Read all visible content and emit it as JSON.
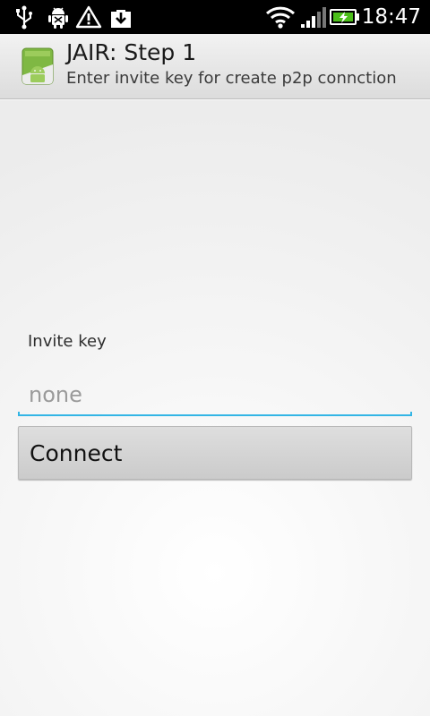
{
  "status_bar": {
    "time": "18:47",
    "icons": [
      "usb-icon",
      "android-debug-icon",
      "warning-icon",
      "download-icon",
      "wifi-icon",
      "signal-icon",
      "battery-charging-icon"
    ]
  },
  "title_bar": {
    "title": "JAIR: Step 1",
    "subtitle": "Enter invite key for create p2p connction",
    "icon": "android-app-icon"
  },
  "form": {
    "invite_label": "Invite key",
    "invite_placeholder": "none",
    "invite_value": "",
    "connect_label": "Connect"
  },
  "colors": {
    "accent": "#33b5e5",
    "battery": "#4cbf1a",
    "status_bar": "#000000"
  }
}
